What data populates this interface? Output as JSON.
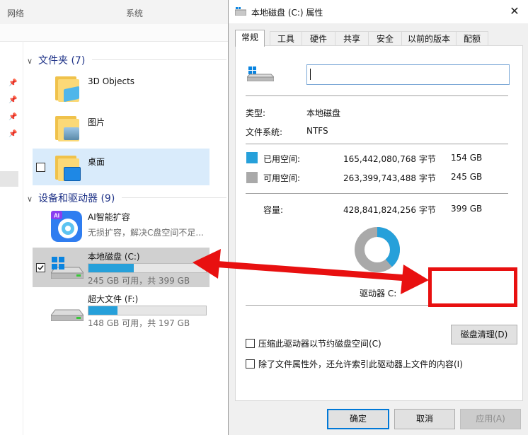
{
  "explorer": {
    "top_columns": [
      "网络",
      "系统"
    ],
    "groups": [
      {
        "title": "文件夹 (7)"
      },
      {
        "title": "设备和驱动器 (9)"
      }
    ],
    "folders": [
      {
        "label": "3D Objects",
        "badge_color": "#4fb6ea"
      },
      {
        "label": "图片",
        "badge_color": "#6a9bbf"
      },
      {
        "label": "桌面",
        "badge_color": "#1e88e5"
      }
    ],
    "app_item": {
      "title": "AI智能扩容",
      "subtitle": "无损扩容，解决C盘空间不足..."
    },
    "drives": [
      {
        "title": "本地磁盘 (C:)",
        "subtitle": "245 GB 可用，共 399 GB",
        "used_fraction": 0.386
      },
      {
        "title": "超大文件 (F:)",
        "subtitle": "148 GB 可用，共 197 GB",
        "used_fraction": 0.249
      }
    ]
  },
  "dialog": {
    "title": "本地磁盘 (C:) 属性",
    "close_glyph": "✕",
    "tabs": [
      "常规",
      "工具",
      "硬件",
      "共享",
      "安全",
      "以前的版本",
      "配额"
    ],
    "active_tab": "常规",
    "name_value": "",
    "type_label": "类型:",
    "type_value": "本地磁盘",
    "fs_label": "文件系统:",
    "fs_value": "NTFS",
    "used_label": "已用空间:",
    "used_bytes": "165,442,080,768 字节",
    "used_gb": "154 GB",
    "free_label": "可用空间:",
    "free_bytes": "263,399,743,488 字节",
    "free_gb": "245 GB",
    "cap_label": "容量:",
    "cap_bytes": "428,841,824,256 字节",
    "cap_gb": "399 GB",
    "drive_label": "驱动器 C:",
    "cleanup_button": "磁盘清理(D)",
    "compress_label": "压缩此驱动器以节约磁盘空间(C)",
    "index_label": "除了文件属性外，还允许索引此驱动器上文件的内容(I)",
    "ok": "确定",
    "cancel": "取消",
    "apply": "应用(A)",
    "used_color": "#26a0da",
    "free_color": "#a9a9a9",
    "used_fraction": 0.386
  },
  "annotation_color": "#e81010"
}
